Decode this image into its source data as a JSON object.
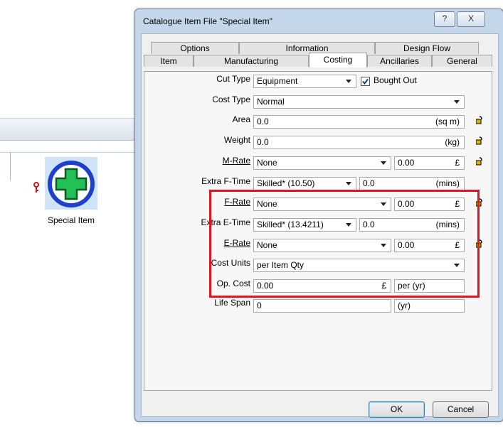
{
  "background": {
    "item_label": "Special Item"
  },
  "dialog": {
    "title": "Catalogue Item File \"Special Item\"",
    "help_glyph": "?",
    "close_glyph": "X",
    "tabs_row1": [
      "Options",
      "Information",
      "Design Flow"
    ],
    "tabs_row2": [
      "Item",
      "Manufacturing",
      "Costing",
      "Ancillaries",
      "General"
    ],
    "active_tab": "Costing",
    "labels": {
      "cut_type": "Cut Type",
      "cost_type": "Cost Type",
      "area": "Area",
      "weight": "Weight",
      "m_rate": "M-Rate",
      "extra_f_time": "Extra F-Time",
      "f_rate": "F-Rate",
      "extra_e_time": "Extra E-Time",
      "e_rate": "E-Rate",
      "cost_units": "Cost Units",
      "op_cost": "Op. Cost",
      "life_span": "Life Span"
    },
    "fields": {
      "cut_type": "Equipment",
      "bought_out_label": "Bought Out",
      "bought_out_checked": true,
      "cost_type": "Normal",
      "area": "0.0",
      "area_unit": "(sq m)",
      "weight": "0.0",
      "weight_unit": "(kg)",
      "m_rate": "None",
      "m_rate_value": "0.00",
      "m_rate_unit": "£",
      "extra_f_time": "Skilled* (10.50)",
      "extra_f_time_value": "0.0",
      "extra_f_time_unit": "(mins)",
      "f_rate": "None",
      "f_rate_value": "0.00",
      "f_rate_unit": "£",
      "extra_e_time": "Skilled* (13.4211)",
      "extra_e_time_value": "0.0",
      "extra_e_time_unit": "(mins)",
      "e_rate": "None",
      "e_rate_value": "0.00",
      "e_rate_unit": "£",
      "cost_units": "per Item Qty",
      "op_cost": "0.00",
      "op_cost_unit": "£",
      "op_cost_period": "per (yr)",
      "life_span": "0",
      "life_span_unit": "(yr)"
    },
    "buttons": {
      "ok": "OK",
      "cancel": "Cancel"
    },
    "colors": {
      "highlight": "#e3141f",
      "frame": "#c3d6ea",
      "icon_green": "#22c055",
      "icon_blue": "#1f3fcf"
    }
  }
}
